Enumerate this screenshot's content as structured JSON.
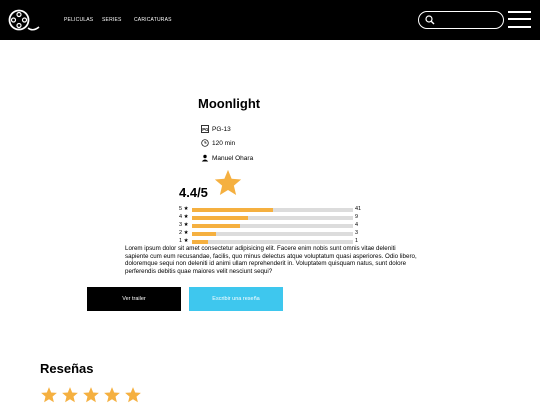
{
  "header": {
    "logo_icon": "film-reel-logo-icon",
    "nav": [
      "PELICULAS",
      "SERIES",
      "CARICATURAS"
    ],
    "search": {
      "placeholder": "",
      "icon": "search-icon"
    },
    "menu_icon": "hamburger-menu-icon"
  },
  "movie": {
    "title": "Moonlight",
    "rating_label": "PG-13",
    "duration": "120 min",
    "director": "Manuel Ohara"
  },
  "score": {
    "average": "4.4/5",
    "accent": "#f5b040",
    "distribution": [
      {
        "label": "5 ★",
        "count": "41",
        "fraction": 0.5
      },
      {
        "label": "4 ★",
        "count": "9",
        "fraction": 0.35
      },
      {
        "label": "3 ★",
        "count": "4",
        "fraction": 0.3
      },
      {
        "label": "2 ★",
        "count": "3",
        "fraction": 0.15
      },
      {
        "label": "1 ★",
        "count": "1",
        "fraction": 0.1
      }
    ]
  },
  "description": "Lorem ipsum dolor sit amet consectetur adipisicing elit. Facere enim nobis sunt omnis vitae deleniti sapiente cum eum recusandae, facilis, quo minus delectus atque voluptatum quasi asperiores. Odio libero, doloremque sequi non deleniti id animi ullam reprehenderit in. Voluptatem quisquam natus, sunt dolore perferendis debitis quae maiores velit nesciunt sequi?",
  "buttons": {
    "trailer": "Ver trailer",
    "review": "Escribir una reseña",
    "review_color": "#3ec7ee"
  },
  "reviews": {
    "title": "Reseñas",
    "stars": 5
  }
}
